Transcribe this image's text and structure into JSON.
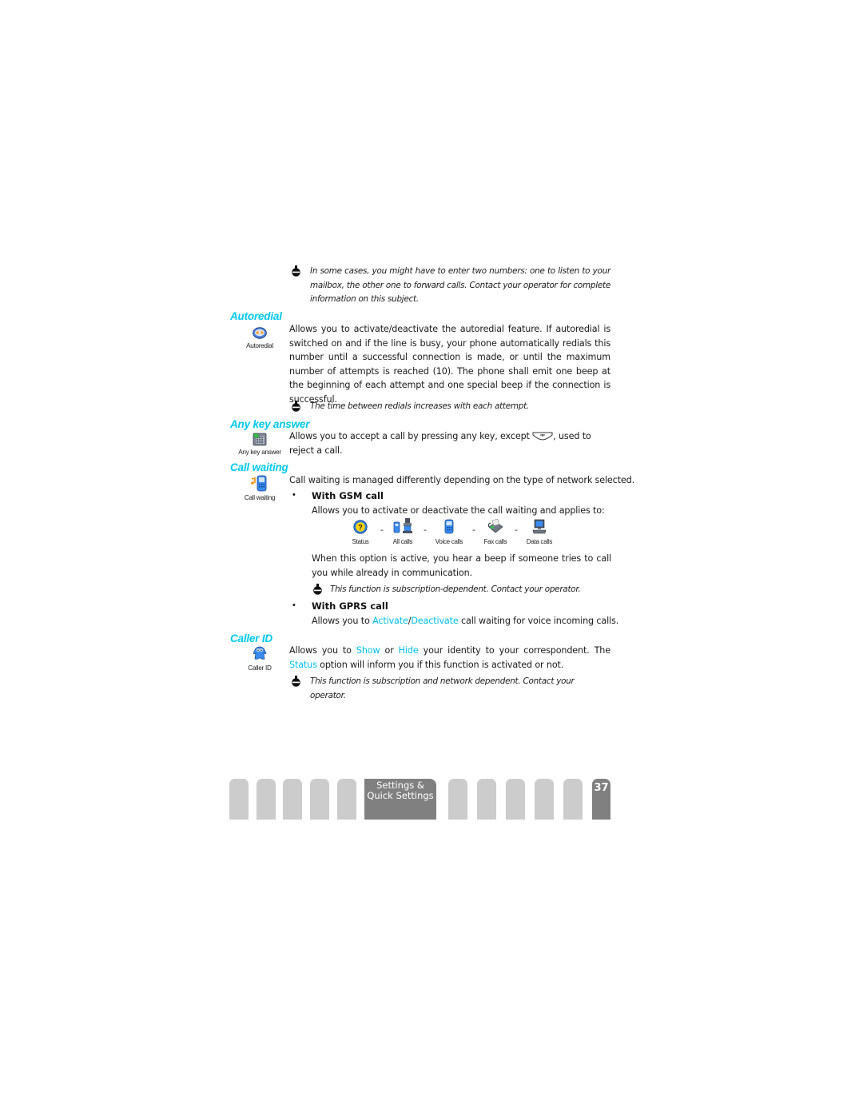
{
  "intro_note": {
    "icon": "note-hand-icon",
    "text": "In some cases, you might have to enter two numbers: one to listen to your mailbox, the other one to forward calls. Contact your operator for complete information on this subject."
  },
  "sections": {
    "autoredial": {
      "heading": "Autoredial",
      "icon": "autoredial-icon",
      "icon_caption": "Autoredial",
      "body": "Allows you to activate/deactivate the autoredial feature. If autoredial is switched on and if the line is busy, your phone automatically redials this number until a successful connection is made, or until the maximum number of attempts is reached (10). The phone shall emit one beep at the beginning of each attempt and one special beep if the connection is successful.",
      "note": "The time between redials increases with each attempt."
    },
    "any_key_answer": {
      "heading": "Any key answer",
      "icon": "any-key-answer-icon",
      "icon_caption": "Any key answer",
      "body_before": "Allows you to accept a call by pressing any key, except",
      "key_icon": "hang-up-key-icon",
      "body_after": ", used to reject a call."
    },
    "call_waiting": {
      "heading": "Call waiting",
      "icon": "call-waiting-icon",
      "icon_caption": "Call waiting",
      "intro": "Call waiting is managed differently depending on the type of network selected.",
      "gsm": {
        "bullet": "•",
        "title": "With GSM call",
        "body": "Allows you to activate or deactivate the call waiting and applies to:",
        "modes": [
          {
            "icon": "status-icon",
            "label": "Status"
          },
          {
            "icon": "all-calls-icon",
            "label": "All calls"
          },
          {
            "icon": "voice-calls-icon",
            "label": "Voice calls"
          },
          {
            "icon": "fax-calls-icon",
            "label": "Fax calls"
          },
          {
            "icon": "data-calls-icon",
            "label": "Data calls"
          }
        ],
        "separator": "-",
        "after": "When this option is active, you hear a beep if someone tries to call you while already in communication.",
        "note": "This function is subscription-dependent. Contact your operator."
      },
      "gprs": {
        "bullet": "•",
        "title": "With GPRS call",
        "body_before": "Allows you to ",
        "link1": "Activate",
        "slash": "/",
        "link2": "Deactivate",
        "body_after": " call waiting for voice incoming calls."
      }
    },
    "caller_id": {
      "heading": "Caller ID",
      "icon": "caller-id-icon",
      "icon_caption": "Caller ID",
      "body_p1": "Allows you to ",
      "link_show": "Show",
      "body_p2": " or ",
      "link_hide": "Hide",
      "body_p3": " your identity to your correspondent. The ",
      "link_status": "Status",
      "body_p4": " option will inform you if this function is activated or not.",
      "note": "This function is subscription and network dependent. Contact your operator."
    }
  },
  "footer": {
    "chapter_line1": "Settings &",
    "chapter_line2": "Quick Settings",
    "page_number": "37"
  },
  "colors": {
    "heading": "#00c8f0",
    "link": "#00c0ee",
    "tab_inactive": "#cccccc",
    "tab_active": "#808080"
  }
}
